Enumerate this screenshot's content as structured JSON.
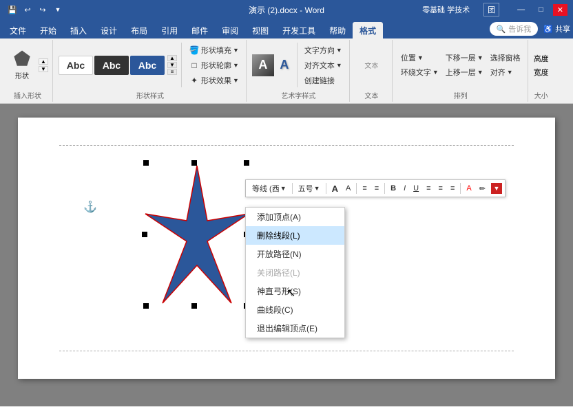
{
  "titleBar": {
    "fileName": "演示 (2).docx",
    "appName": "Word",
    "separator": " - ",
    "rightLinks": [
      "零基础 学技术",
      "团",
      "—",
      "□",
      "×"
    ],
    "quickAccess": [
      "↩",
      "↪",
      "💾",
      "✎",
      "▼"
    ]
  },
  "ribbonTabs": {
    "tabs": [
      "文件",
      "开始",
      "插入",
      "设计",
      "布局",
      "引用",
      "邮件",
      "审阅",
      "视图",
      "开发工具",
      "帮助",
      "格式"
    ],
    "activeTab": "格式"
  },
  "ribbon": {
    "groups": [
      {
        "label": "插入形状",
        "buttons": [
          "形状"
        ]
      },
      {
        "label": "形状样式",
        "items": [
          "形状填充▼",
          "形状轮廓▼",
          "形状效果▼"
        ],
        "styles": [
          "Abc",
          "Abc",
          "Abc"
        ]
      },
      {
        "label": "艺术字样式",
        "items": [
          "A",
          "A"
        ],
        "subitems": [
          "文字方向",
          "对齐文本",
          "创建链接"
        ]
      },
      {
        "label": "文本",
        "items": [
          "文字方向▼",
          "对齐文本▼",
          "创建链接"
        ]
      },
      {
        "label": "排列",
        "items": [
          "位置▼",
          "下移一层▼",
          "选择窗格",
          "环绕文字▼",
          "上移一层▼",
          "对齐▼"
        ]
      },
      {
        "label": "大小",
        "items": [
          "高度",
          "宽度"
        ]
      }
    ]
  },
  "miniToolbar": {
    "fontName": "等线 (西",
    "fontSize": "五号",
    "fontDropdown": "▼",
    "sizeDropdown": "▼",
    "increaseFont": "A",
    "decreaseFont": "A",
    "alignLeft": "≡",
    "alignCenter": "≡",
    "bold": "B",
    "italic": "I",
    "underline": "U",
    "alignMore": "≡",
    "alignMore2": "≡",
    "fontColor": "A",
    "highlight": "✏"
  },
  "contextMenu": {
    "items": [
      {
        "label": "添加顶点(A)",
        "disabled": false,
        "highlighted": false
      },
      {
        "label": "删除线段(L)",
        "disabled": false,
        "highlighted": true
      },
      {
        "label": "开放路径(N)",
        "disabled": false,
        "highlighted": false
      },
      {
        "label": "关闭路径(L)",
        "disabled": true,
        "highlighted": false
      },
      {
        "label": "神直弓形(S)",
        "disabled": false,
        "highlighted": false
      },
      {
        "label": "曲线段(C)",
        "disabled": false,
        "highlighted": false
      },
      {
        "label": "退出编辑顶点(E)",
        "disabled": false,
        "highlighted": false
      }
    ]
  },
  "page": {
    "cursor": "pointer"
  }
}
